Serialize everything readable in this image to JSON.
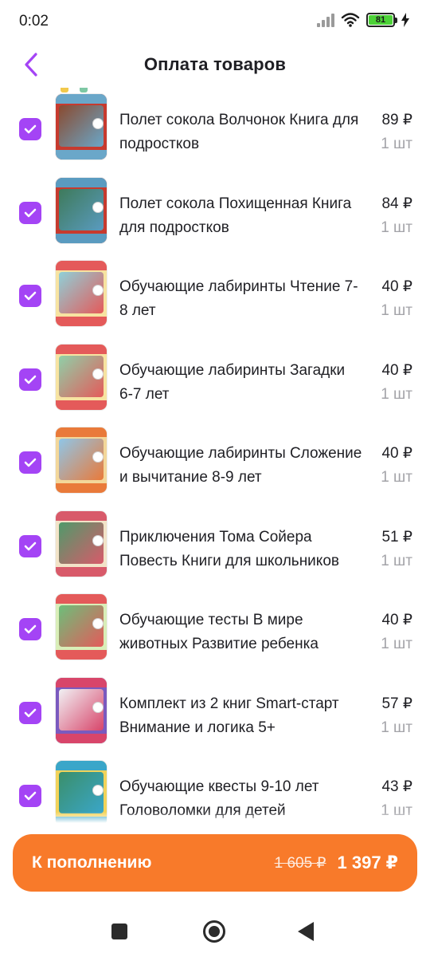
{
  "status_bar": {
    "time": "0:02",
    "battery_level": "81",
    "icons": [
      "signal-icon",
      "wifi-icon",
      "battery-icon",
      "charging-icon"
    ]
  },
  "header": {
    "title": "Оплата товаров",
    "back_icon": "chevron-left-icon"
  },
  "colors": {
    "accent": "#a444f5",
    "pay_button": "#f87a2a",
    "text_primary": "#1f1f24",
    "text_secondary": "#a3a3a8"
  },
  "items": [
    {
      "name": "Полет сокола Волчонок Книга для подростков",
      "price": "89 ₽",
      "qty": "1 шт",
      "checked": true,
      "thumb_colors": [
        "#6aa7c9",
        "#8a4a2f",
        "#c73a2e"
      ]
    },
    {
      "name": "Полет сокола Похищенная Книга для подростков",
      "price": "84 ₽",
      "qty": "1 шт",
      "checked": true,
      "thumb_colors": [
        "#5a9bc0",
        "#3e7a5a",
        "#c73a2e"
      ]
    },
    {
      "name": "Обучающие лабиринты Чтение 7-8 лет",
      "price": "40 ₽",
      "qty": "1 шт",
      "checked": true,
      "thumb_colors": [
        "#e45a5a",
        "#8fd0d8",
        "#f7e3a1"
      ]
    },
    {
      "name": "Обучающие лабиринты Загадки 6-7 лет",
      "price": "40 ₽",
      "qty": "1 шт",
      "checked": true,
      "thumb_colors": [
        "#e45a5a",
        "#8fd0a8",
        "#f7e3a1"
      ]
    },
    {
      "name": "Обучающие лабиринты Сложение и вычитание 8-9 лет",
      "price": "40 ₽",
      "qty": "1 шт",
      "checked": true,
      "thumb_colors": [
        "#e97a3a",
        "#8fc6e8",
        "#f3d79a"
      ]
    },
    {
      "name": "Приключения Тома Сойера Повесть Книги для школьников",
      "price": "51 ₽",
      "qty": "1 шт",
      "checked": true,
      "thumb_colors": [
        "#d85a6a",
        "#4f9a6a",
        "#f2e3c8"
      ]
    },
    {
      "name": "Обучающие тесты В мире животных Развитие ребенка",
      "price": "40 ₽",
      "qty": "1 шт",
      "checked": true,
      "thumb_colors": [
        "#e45a5a",
        "#6cbf7a",
        "#d9eeb8"
      ]
    },
    {
      "name": "Комплект из 2 книг Smart-старт Внимание и логика 5+",
      "price": "57 ₽",
      "qty": "1 шт",
      "checked": true,
      "thumb_colors": [
        "#d8456a",
        "#f1f1f4",
        "#7a5abf"
      ]
    },
    {
      "name": "Обучающие квесты 9-10 лет Головоломки для детей",
      "price": "43 ₽",
      "qty": "1 шт",
      "checked": true,
      "thumb_colors": [
        "#3aa6c9",
        "#3a8f6a",
        "#f2d35a"
      ]
    }
  ],
  "checkout": {
    "label": "К пополнению",
    "old_total": "1 605 ₽",
    "new_total": "1 397 ₽"
  },
  "system_nav": {
    "icons": [
      "recents-square-icon",
      "home-circle-icon",
      "back-triangle-icon"
    ]
  }
}
